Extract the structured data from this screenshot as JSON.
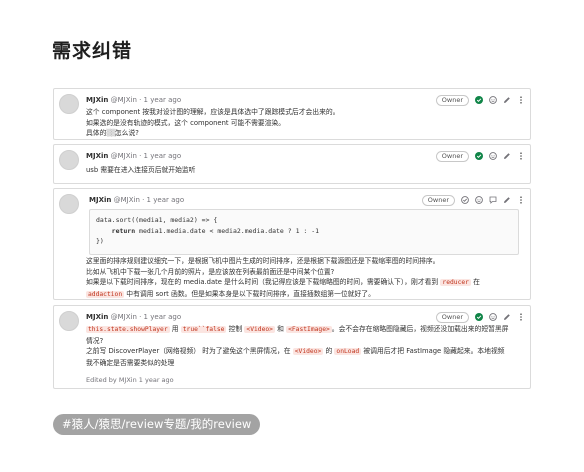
{
  "page": {
    "title": "需求纠错"
  },
  "colors": {
    "resolve_green": "#108548",
    "chip_bg": "#fbe5e1",
    "chip_fg": "#c0341d",
    "tag_bg": "#a3a3a3"
  },
  "notes": [
    {
      "author": "MJXin",
      "handle": "@MJXin",
      "time": "· 1 year ago",
      "badge": "Owner",
      "lines": [
        "这个 component 按我对设计图的理解，应该是具体选中了跟踪模式后才会出来的。",
        "如果选的是没有轨迹的模式，这个 component 可能不需要渲染。"
      ],
      "line3_prefix": "具体的",
      "line3_suffix": "怎么说?"
    },
    {
      "author": "MJXin",
      "handle": "@MJXin",
      "time": "· 1 year ago",
      "badge": "Owner",
      "text": "usb 需要在进入连接页后就开始监听"
    },
    {
      "author": "MJXin",
      "handle": "@MJXin",
      "time": "· 1 year ago",
      "badge": "Owner",
      "code": {
        "line1": "data.sort((media1, media2) => {",
        "line2_kw": "return",
        "line2_rest": " media1.media.date < media2.media.date ? 1 : -1",
        "line3": "})"
      },
      "lines": [
        "这里面的排序规则建议细究一下，是根据飞机中图片生成的时间排序，还是根据下载源图还是下载缩率图的时间排序。",
        "比如从飞机中下载一张几个月前的照片，是应该放在列表最前面还是中间某个位置?"
      ],
      "line3_a": "如果是以下载时间排序，现在的 media.date 是什么时间（我记得应该是下载缩略图的时间，需要确认下），刚才看到",
      "line3_code": "reducer",
      "line3_b": "在",
      "line4_code": "addaction",
      "line4_b": "中有调用 sort 函数。但是如果本身是以下载时间排序，直接插数组第一位就好了。"
    },
    {
      "author": "MJXin",
      "handle": "@MJXin",
      "time": "· 1 year ago",
      "badge": "Owner",
      "code1": "this.state.showPlayer",
      "t1": "用",
      "code2": "true``false",
      "t2": "控制",
      "code3": "<Video>",
      "t3": "和",
      "code4": "<FastImage>",
      "t4": "。会不会存在缩略图隐藏后，视频还没加载出来的短暂黑屏",
      "line2": "情况?",
      "l3a": "之前写 DiscoverPlayer（网络视频） 时为了避免这个黑屏情况，在",
      "code5": "<Video>",
      "l3b": "的",
      "code6": "onLoad",
      "l3c": "被调用后才把 FastImage 隐藏起来。本地视频",
      "line4": "我不确定是否需要类似的处理",
      "edited": "Edited by MJXin 1 year ago"
    }
  ],
  "tag": {
    "prefix": "#猿人/猿思/review专题/我的review"
  }
}
